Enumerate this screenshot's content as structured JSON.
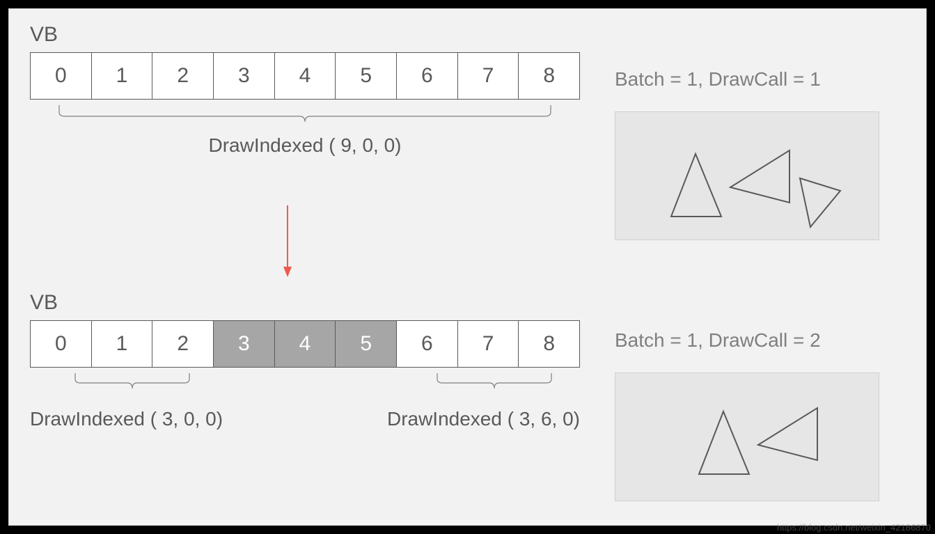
{
  "top": {
    "vb_label": "VB",
    "cells": [
      "0",
      "1",
      "2",
      "3",
      "4",
      "5",
      "6",
      "7",
      "8"
    ],
    "draw_label": "DrawIndexed ( 9, 0, 0)",
    "batch_label": "Batch = 1, DrawCall = 1"
  },
  "bottom": {
    "vb_label": "VB",
    "cells": [
      {
        "v": "0",
        "shaded": false
      },
      {
        "v": "1",
        "shaded": false
      },
      {
        "v": "2",
        "shaded": false
      },
      {
        "v": "3",
        "shaded": true
      },
      {
        "v": "4",
        "shaded": true
      },
      {
        "v": "5",
        "shaded": true
      },
      {
        "v": "6",
        "shaded": false
      },
      {
        "v": "7",
        "shaded": false
      },
      {
        "v": "8",
        "shaded": false
      }
    ],
    "draw_label_left": "DrawIndexed ( 3, 0, 0)",
    "draw_label_right": "DrawIndexed ( 3, 6, 0)",
    "batch_label": "Batch = 1, DrawCall = 2"
  },
  "watermark": "https://blog.csdn.net/weixin_42186870"
}
